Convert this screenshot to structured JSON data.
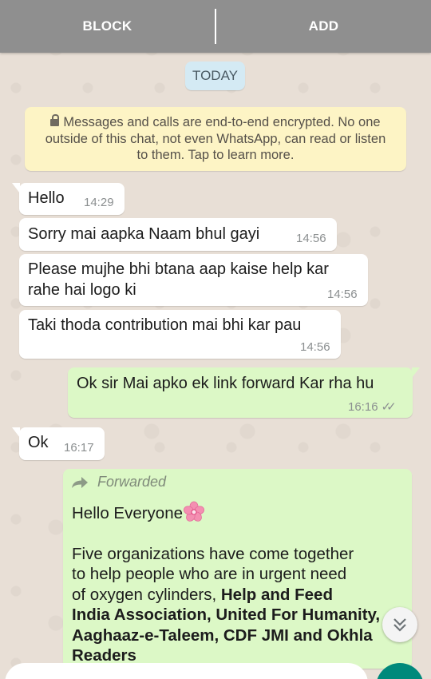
{
  "top_bar": {
    "block_label": "BLOCK",
    "add_label": "ADD"
  },
  "date_chip": "TODAY",
  "encryption_notice": {
    "line1": "Messages and calls are end-to-end encrypted. No one",
    "line2": "outside of this chat, not even WhatsApp, can read or listen",
    "line3": "to them. Tap to learn more."
  },
  "messages": [
    {
      "direction": "incoming",
      "text": "Hello",
      "time": "14:29"
    },
    {
      "direction": "incoming",
      "text": "Sorry mai aapka Naam bhul gayi",
      "time": "14:56"
    },
    {
      "direction": "incoming",
      "line1": "Please mujhe bhi btana aap kaise help kar",
      "line2": "rahe hai logo ki",
      "time": "14:56"
    },
    {
      "direction": "incoming",
      "text": "Taki thoda contribution mai bhi kar pau",
      "time": "14:56"
    },
    {
      "direction": "outgoing",
      "text": "Ok sir Mai apko ek link forward Kar rha hu",
      "time": "16:16",
      "status": "read-double-tick"
    },
    {
      "direction": "incoming",
      "text": "Ok",
      "time": "16:17"
    }
  ],
  "forwarded_message": {
    "label": "Forwarded",
    "greeting": "Hello Everyone",
    "greeting_emoji": "cherry-blossom",
    "line1": "Five organizations have come together",
    "line2": "to help people who are in urgent need",
    "line3_plain": "of oxygen cylinders, ",
    "line3_bold": "Help and Feed",
    "line4_bold": "India Association, United For Humanity,",
    "line5_bold": "Aaghaaz-e-Taleem, CDF JMI and Okhla",
    "line6_bold": "Readers"
  },
  "colors": {
    "top_bar": "#8f8f8f",
    "outgoing_bubble": "#dcf8c6",
    "incoming_bubble": "#ffffff",
    "encryption_bg": "#fdf4c5",
    "date_chip_bg": "#d4eaf4",
    "accent": "#00897b"
  }
}
